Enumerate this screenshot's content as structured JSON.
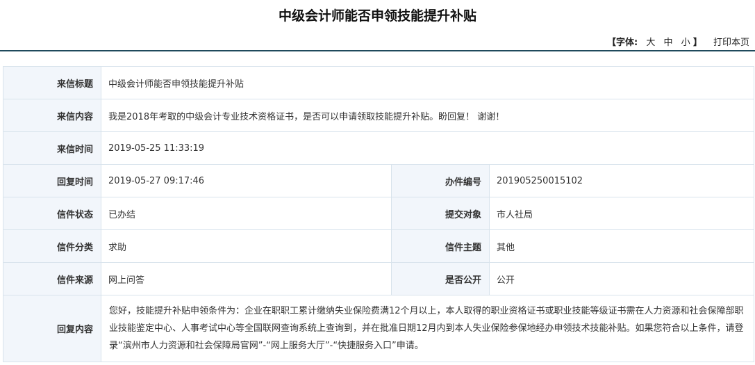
{
  "page": {
    "title": "中级会计师能否申领技能提升补贴"
  },
  "toolbar": {
    "bracket_open": "【",
    "font_label": "字体:",
    "size_large": "大",
    "size_medium": "中",
    "size_small": "小",
    "bracket_close": "】",
    "print_label": "打印本页"
  },
  "letter": {
    "subject_label": "来信标题",
    "subject": "中级会计师能否申领技能提升补贴",
    "content_label": "来信内容",
    "content": "我是2018年考取的中级会计专业技术资格证书，是否可以申请领取技能提升补贴。盼回复！ 谢谢！",
    "sent_time_label": "来信时间",
    "sent_time": "2019-05-25 11:33:19",
    "reply_time_label": "回复时间",
    "reply_time": "2019-05-27 09:17:46",
    "case_no_label": "办件编号",
    "case_no": "201905250015102",
    "status_label": "信件状态",
    "status": "已办结",
    "target_label": "提交对象",
    "target": "市人社局",
    "category_label": "信件分类",
    "category": "求助",
    "topic_label": "信件主题",
    "topic": "其他",
    "source_label": "信件来源",
    "source": "网上问答",
    "public_label": "是否公开",
    "public": "公开",
    "reply_label": "回复内容",
    "reply": "您好，技能提升补贴申领条件为：企业在职职工累计缴纳失业保险费满12个月以上，本人取得的职业资格证书或职业技能等级证书需在人力资源和社会保障部职业技能鉴定中心、人事考试中心等全国联网查询系统上查询到，并在批准日期12月内到本人失业保险参保地经办申领技术技能补贴。如果您符合以上条件，请登录“滨州市人力资源和社会保障局官网”-“网上服务大厅”-“快捷服务入口”申请。"
  }
}
